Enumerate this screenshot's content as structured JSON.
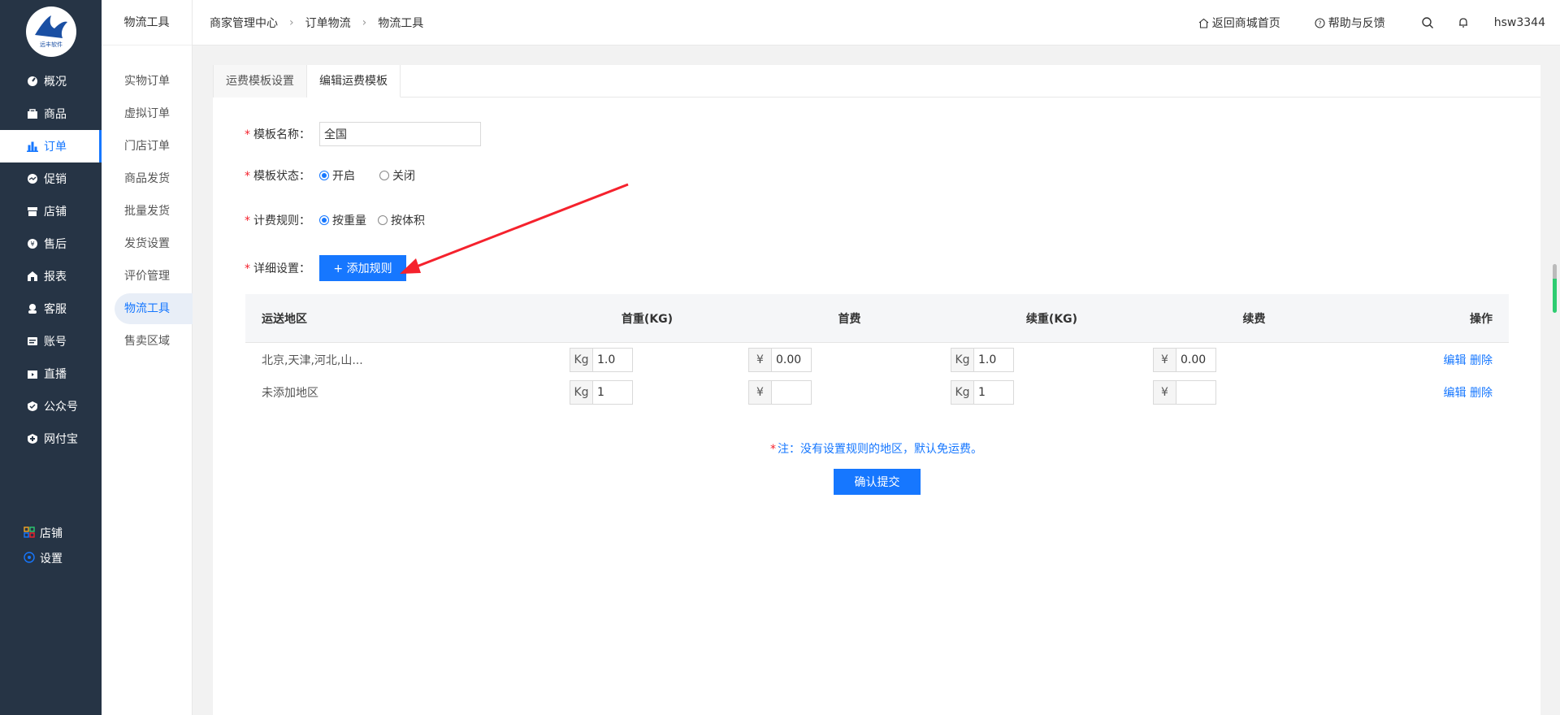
{
  "sidebar": {
    "logo_text": "远丰软件",
    "items": [
      {
        "label": "概况",
        "icon": "dashboard-icon"
      },
      {
        "label": "商品",
        "icon": "bag-icon"
      },
      {
        "label": "订单",
        "icon": "bar-chart-icon"
      },
      {
        "label": "促销",
        "icon": "promotion-icon"
      },
      {
        "label": "店铺",
        "icon": "store-icon"
      },
      {
        "label": "售后",
        "icon": "after-sale-icon"
      },
      {
        "label": "报表",
        "icon": "report-icon"
      },
      {
        "label": "客服",
        "icon": "customer-service-icon"
      },
      {
        "label": "账号",
        "icon": "account-icon"
      },
      {
        "label": "直播",
        "icon": "live-icon"
      },
      {
        "label": "公众号",
        "icon": "official-account-icon"
      },
      {
        "label": "网付宝",
        "icon": "payment-icon"
      }
    ],
    "active_index": 2,
    "bottom": [
      {
        "label": "店铺",
        "icon": "grid-icon"
      },
      {
        "label": "设置",
        "icon": "settings-icon"
      }
    ]
  },
  "subnav": {
    "title": "物流工具",
    "items": [
      "实物订单",
      "虚拟订单",
      "门店订单",
      "商品发货",
      "批量发货",
      "发货设置",
      "评价管理",
      "物流工具",
      "售卖区域"
    ],
    "active_index": 7
  },
  "header": {
    "breadcrumb": [
      "商家管理中心",
      "订单物流",
      "物流工具"
    ],
    "back_home": "返回商城首页",
    "help": "帮助与反馈",
    "username": "hsw3344"
  },
  "tabs": [
    "运费模板设置",
    "编辑运费模板"
  ],
  "active_tab": 1,
  "form": {
    "name_label": "模板名称：",
    "name_value": "全国",
    "status_label": "模板状态：",
    "status_options": [
      "开启",
      "关闭"
    ],
    "status_selected": 0,
    "rule_label": "计费规则：",
    "rule_options": [
      "按重量",
      "按体积"
    ],
    "rule_selected": 0,
    "detail_label": "详细设置：",
    "add_rule_button": "+ 添加规则"
  },
  "table": {
    "headers": [
      "运送地区",
      "首重(KG)",
      "首费",
      "续重(KG)",
      "续费",
      "操作"
    ],
    "rows": [
      {
        "region": "北京,天津,河北,山...",
        "first_weight_unit": "Kg",
        "first_weight": "1.0",
        "first_fee_unit": "¥",
        "first_fee": "0.00",
        "extra_weight_unit": "Kg",
        "extra_weight": "1.0",
        "extra_fee_unit": "¥",
        "extra_fee": "0.00",
        "edit": "编辑",
        "delete": "删除"
      },
      {
        "region": "未添加地区",
        "first_weight_unit": "Kg",
        "first_weight": "1",
        "first_fee_unit": "¥",
        "first_fee": "",
        "extra_weight_unit": "Kg",
        "extra_weight": "1",
        "extra_fee_unit": "¥",
        "extra_fee": "",
        "edit": "编辑",
        "delete": "删除"
      }
    ]
  },
  "note": {
    "star": "*",
    "text": "注：没有设置规则的地区，默认免运费。"
  },
  "submit_button": "确认提交",
  "colors": {
    "sidebar_bg": "#263445",
    "accent": "#1677ff",
    "required": "#f5222d",
    "arrow": "#f5222d"
  }
}
